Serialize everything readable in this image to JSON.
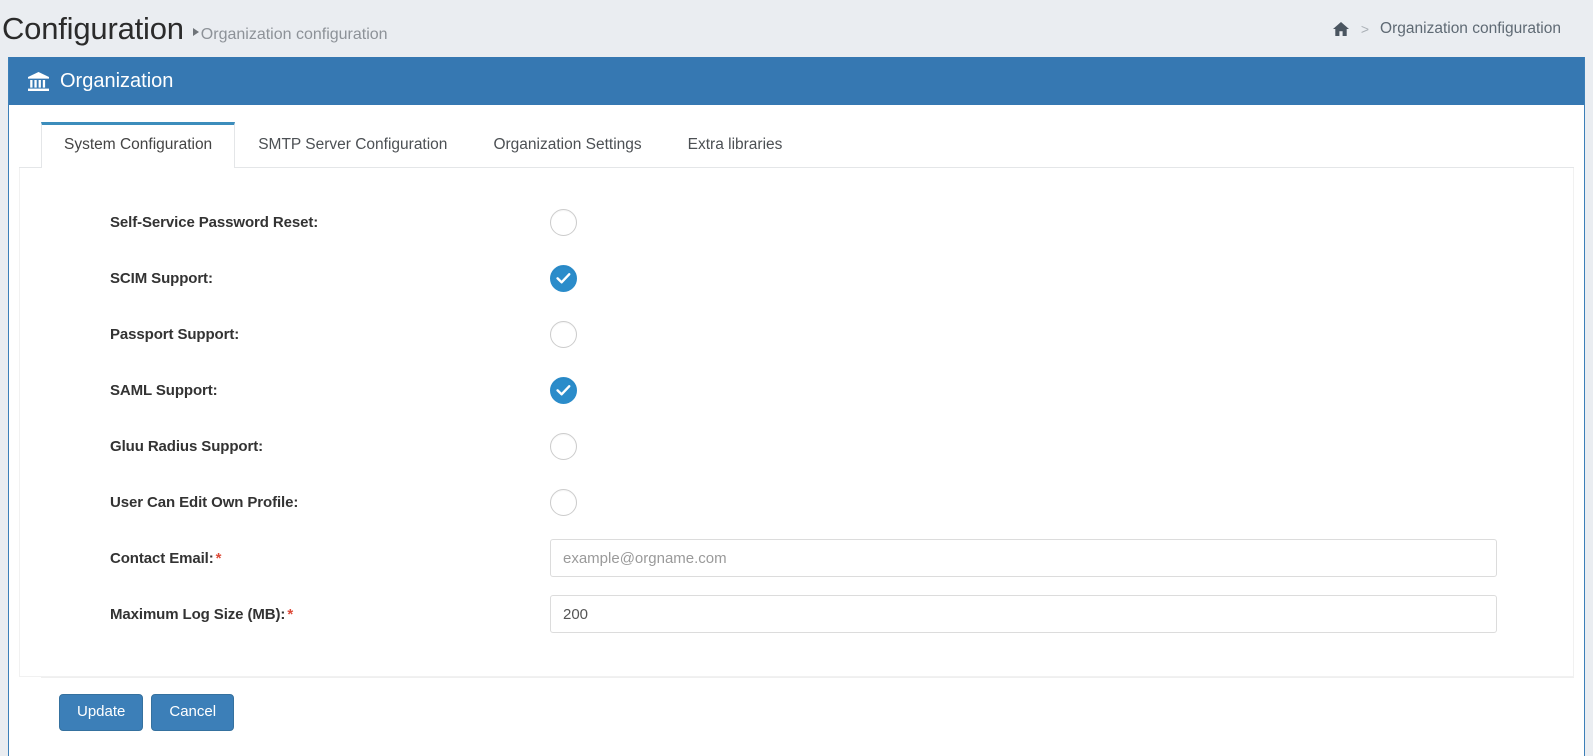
{
  "header": {
    "title": "Configuration",
    "subtitle": "Organization configuration",
    "breadcrumb": {
      "home_icon": "home-icon",
      "separator": ">",
      "current": "Organization configuration"
    }
  },
  "panel": {
    "icon": "bank-icon",
    "title": "Organization"
  },
  "tabs": [
    {
      "label": "System Configuration",
      "active": true
    },
    {
      "label": "SMTP Server Configuration",
      "active": false
    },
    {
      "label": "Organization Settings",
      "active": false
    },
    {
      "label": "Extra libraries",
      "active": false
    }
  ],
  "form": {
    "toggles": [
      {
        "label": "Self-Service Password Reset:",
        "checked": false,
        "name": "self-service-password-reset"
      },
      {
        "label": "SCIM Support:",
        "checked": true,
        "name": "scim-support"
      },
      {
        "label": "Passport Support:",
        "checked": false,
        "name": "passport-support"
      },
      {
        "label": "SAML Support:",
        "checked": true,
        "name": "saml-support"
      },
      {
        "label": "Gluu Radius Support:",
        "checked": false,
        "name": "gluu-radius-support"
      },
      {
        "label": "User Can Edit Own Profile:",
        "checked": false,
        "name": "user-can-edit-own-profile"
      }
    ],
    "contact_email": {
      "label": "Contact Email:",
      "required_marker": "*",
      "placeholder": "example@orgname.com",
      "value": ""
    },
    "max_log_size": {
      "label": "Maximum Log Size (MB):",
      "required_marker": "*",
      "placeholder": "",
      "value": "200"
    }
  },
  "footer": {
    "update_label": "Update",
    "cancel_label": "Cancel"
  },
  "colors": {
    "panel_header_blue": "#3678b2",
    "accent_blue": "#3c8dbc",
    "checked_blue": "#2b8cca",
    "button_blue": "#3c7fb8",
    "required_red": "#dd4b39",
    "page_bg": "#eaedf1"
  }
}
